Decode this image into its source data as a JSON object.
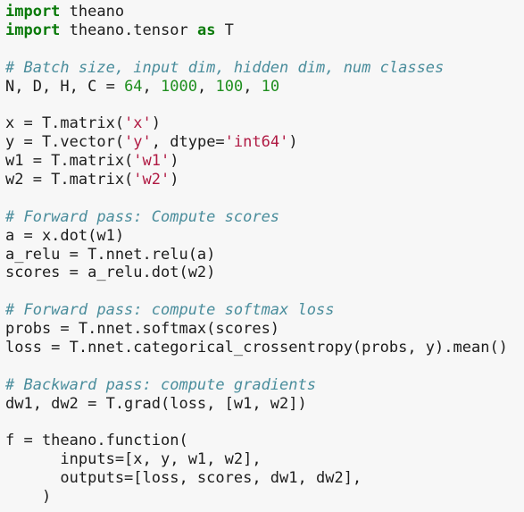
{
  "code": {
    "lines": [
      [
        {
          "t": "import",
          "c": "kw"
        },
        {
          "t": " theano",
          "c": "plain"
        }
      ],
      [
        {
          "t": "import",
          "c": "kw"
        },
        {
          "t": " theano.tensor ",
          "c": "plain"
        },
        {
          "t": "as",
          "c": "kw"
        },
        {
          "t": " T",
          "c": "plain"
        }
      ],
      [],
      [
        {
          "t": "# Batch size, input dim, hidden dim, num classes",
          "c": "com"
        }
      ],
      [
        {
          "t": "N, D, H, C = ",
          "c": "plain"
        },
        {
          "t": "64",
          "c": "num"
        },
        {
          "t": ", ",
          "c": "plain"
        },
        {
          "t": "1000",
          "c": "num"
        },
        {
          "t": ", ",
          "c": "plain"
        },
        {
          "t": "100",
          "c": "num"
        },
        {
          "t": ", ",
          "c": "plain"
        },
        {
          "t": "10",
          "c": "num"
        }
      ],
      [],
      [
        {
          "t": "x = T.matrix(",
          "c": "plain"
        },
        {
          "t": "'x'",
          "c": "str"
        },
        {
          "t": ")",
          "c": "plain"
        }
      ],
      [
        {
          "t": "y = T.vector(",
          "c": "plain"
        },
        {
          "t": "'y'",
          "c": "str"
        },
        {
          "t": ", dtype=",
          "c": "plain"
        },
        {
          "t": "'int64'",
          "c": "str"
        },
        {
          "t": ")",
          "c": "plain"
        }
      ],
      [
        {
          "t": "w1 = T.matrix(",
          "c": "plain"
        },
        {
          "t": "'w1'",
          "c": "str"
        },
        {
          "t": ")",
          "c": "plain"
        }
      ],
      [
        {
          "t": "w2 = T.matrix(",
          "c": "plain"
        },
        {
          "t": "'w2'",
          "c": "str"
        },
        {
          "t": ")",
          "c": "plain"
        }
      ],
      [],
      [
        {
          "t": "# Forward pass: Compute scores",
          "c": "com"
        }
      ],
      [
        {
          "t": "a = x.dot(w1)",
          "c": "plain"
        }
      ],
      [
        {
          "t": "a_relu = T.nnet.relu(a)",
          "c": "plain"
        }
      ],
      [
        {
          "t": "scores = a_relu.dot(w2)",
          "c": "plain"
        }
      ],
      [],
      [
        {
          "t": "# Forward pass: compute softmax loss",
          "c": "com"
        }
      ],
      [
        {
          "t": "probs = T.nnet.softmax(scores)",
          "c": "plain"
        }
      ],
      [
        {
          "t": "loss = T.nnet.categorical_crossentropy(probs, y).mean()",
          "c": "plain"
        }
      ],
      [],
      [
        {
          "t": "# Backward pass: compute gradients",
          "c": "com"
        }
      ],
      [
        {
          "t": "dw1, dw2 = T.grad(loss, [w1, w2])",
          "c": "plain"
        }
      ],
      [],
      [
        {
          "t": "f = theano.function(",
          "c": "plain"
        }
      ],
      [
        {
          "t": "      inputs=[x, y, w1, w2],",
          "c": "plain"
        }
      ],
      [
        {
          "t": "      outputs=[loss, scores, dw1, dw2],",
          "c": "plain"
        }
      ],
      [
        {
          "t": "    )",
          "c": "plain"
        }
      ]
    ]
  },
  "colors": {
    "background": "#f7f7f7",
    "keyword": "#0a7a0a",
    "number": "#1f8f1f",
    "string": "#b01a43",
    "comment": "#4a8d9c",
    "text": "#1c1c1c"
  }
}
